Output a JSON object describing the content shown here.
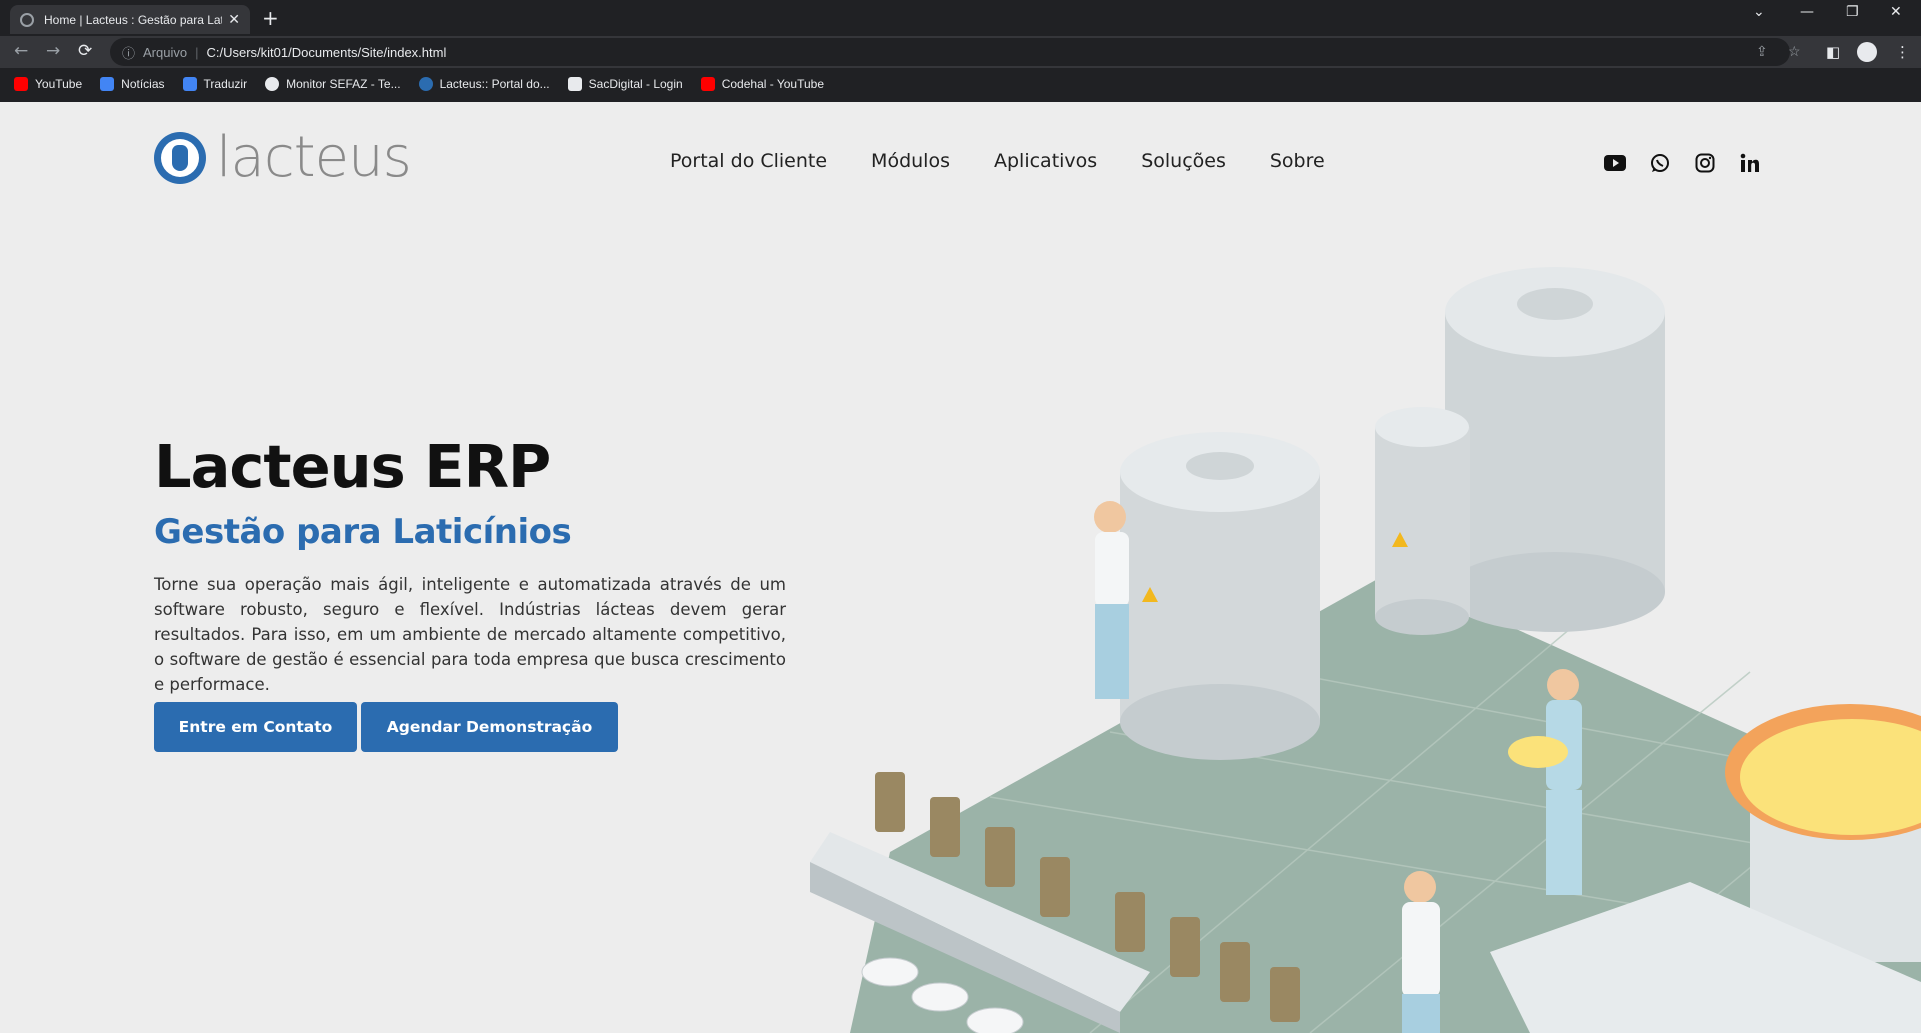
{
  "browser": {
    "tab_title": "Home | Lacteus : Gestão para Lat",
    "address": {
      "protocol": "Arquivo",
      "url": "C:/Users/kit01/Documents/Site/index.html"
    },
    "bookmarks": [
      {
        "label": "YouTube",
        "color": "#ff0000"
      },
      {
        "label": "Notícias",
        "color": "#4285f4"
      },
      {
        "label": "Traduzir",
        "color": "#4285f4"
      },
      {
        "label": "Monitor SEFAZ - Te...",
        "color": "#e8eaed"
      },
      {
        "label": "Lacteus:: Portal do...",
        "color": "#2b6cb0"
      },
      {
        "label": "SacDigital - Login",
        "color": "#e8eaed"
      },
      {
        "label": "Codehal - YouTube",
        "color": "#ff0000"
      }
    ]
  },
  "site": {
    "logo_text": "lacteus",
    "nav": [
      "Portal do Cliente",
      "Módulos",
      "Aplicativos",
      "Soluções",
      "Sobre"
    ],
    "social_icons": [
      "youtube-icon",
      "whatsapp-icon",
      "instagram-icon",
      "linkedin-icon"
    ]
  },
  "hero": {
    "title": "Lacteus ERP",
    "subtitle": "Gestão para Laticínios",
    "body": "Torne sua operação mais ágil, inteligente e automatizada através de um software robusto, seguro e flexível. Indústrias lácteas devem gerar resultados. Para isso, em um ambiente de mercado altamente competitivo, o software de gestão é essencial para toda empresa que busca crescimento e performace.",
    "btn_contact": "Entre em Contato",
    "btn_demo": "Agendar Demonstração"
  },
  "colors": {
    "brand": "#2b6cb0",
    "page_bg": "#ededed",
    "floor": "#9bb3a8"
  }
}
